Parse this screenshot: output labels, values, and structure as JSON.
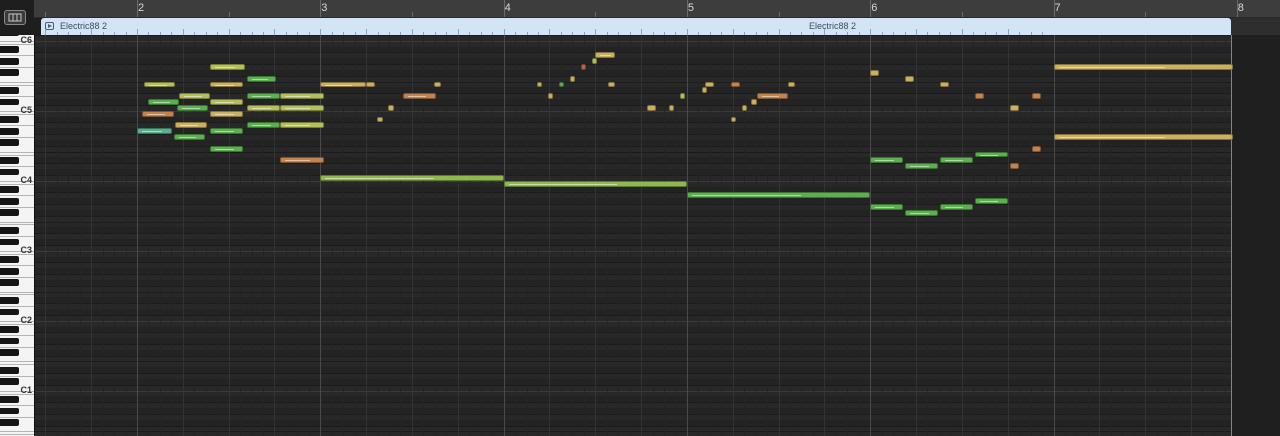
{
  "ruler": {
    "bar_labels": [
      "2",
      "3",
      "4",
      "5",
      "6",
      "7",
      "8"
    ]
  },
  "region": {
    "name_1": "Electric88 2",
    "name_2": "Electric88 2",
    "color": "#d4e4f7"
  },
  "keyboard": {
    "octave_labels": [
      "C6",
      "C5",
      "C4",
      "C3",
      "C2",
      "C1"
    ]
  },
  "colors": {
    "green": "#5cb14f",
    "yellow_green": "#b6c05a",
    "gold": "#c9b062",
    "orange": "#c2834d",
    "teal": "#5ab08d",
    "red_orange": "#c2653f",
    "lime": "#8fb94f"
  },
  "notes": [
    {
      "pitch": 76,
      "start": 1.04,
      "dur": 0.17,
      "color": "yellow_green"
    },
    {
      "pitch": 73,
      "start": 1.06,
      "dur": 0.17,
      "color": "green"
    },
    {
      "pitch": 71,
      "start": 1.03,
      "dur": 0.17,
      "color": "orange"
    },
    {
      "pitch": 68,
      "start": 1.0,
      "dur": 0.19,
      "color": "teal"
    },
    {
      "pitch": 74,
      "start": 1.23,
      "dur": 0.17,
      "color": "yellow_green"
    },
    {
      "pitch": 72,
      "start": 1.22,
      "dur": 0.17,
      "color": "green"
    },
    {
      "pitch": 69,
      "start": 1.21,
      "dur": 0.17,
      "color": "gold"
    },
    {
      "pitch": 67,
      "start": 1.2,
      "dur": 0.17,
      "color": "green"
    },
    {
      "pitch": 79,
      "start": 1.4,
      "dur": 0.19,
      "color": "yellow_green"
    },
    {
      "pitch": 76,
      "start": 1.4,
      "dur": 0.18,
      "color": "gold"
    },
    {
      "pitch": 73,
      "start": 1.4,
      "dur": 0.18,
      "color": "yellow_green"
    },
    {
      "pitch": 71,
      "start": 1.4,
      "dur": 0.18,
      "color": "gold"
    },
    {
      "pitch": 68,
      "start": 1.4,
      "dur": 0.18,
      "color": "green"
    },
    {
      "pitch": 65,
      "start": 1.4,
      "dur": 0.18,
      "color": "green"
    },
    {
      "pitch": 77,
      "start": 1.6,
      "dur": 0.16,
      "color": "green"
    },
    {
      "pitch": 74,
      "start": 1.6,
      "dur": 0.18,
      "color": "green"
    },
    {
      "pitch": 72,
      "start": 1.6,
      "dur": 0.18,
      "color": "yellow_green"
    },
    {
      "pitch": 69,
      "start": 1.6,
      "dur": 0.18,
      "color": "green"
    },
    {
      "pitch": 74,
      "start": 1.78,
      "dur": 0.24,
      "color": "yellow_green"
    },
    {
      "pitch": 72,
      "start": 1.78,
      "dur": 0.24,
      "color": "yellow_green"
    },
    {
      "pitch": 69,
      "start": 1.78,
      "dur": 0.24,
      "color": "yellow_green"
    },
    {
      "pitch": 63,
      "start": 1.78,
      "dur": 0.24,
      "color": "orange"
    },
    {
      "pitch": 76,
      "start": 2.0,
      "dur": 0.25,
      "color": "gold"
    },
    {
      "pitch": 76,
      "start": 2.25,
      "dur": 0.05,
      "color": "gold"
    },
    {
      "pitch": 70,
      "start": 2.31,
      "dur": 0.03,
      "color": "gold"
    },
    {
      "pitch": 72,
      "start": 2.37,
      "dur": 0.03,
      "color": "gold"
    },
    {
      "pitch": 74,
      "start": 2.45,
      "dur": 0.18,
      "color": "orange"
    },
    {
      "pitch": 76,
      "start": 2.62,
      "dur": 0.04,
      "color": "gold"
    },
    {
      "pitch": 60,
      "start": 2.0,
      "dur": 1.0,
      "color": "lime"
    },
    {
      "pitch": 59,
      "start": 3.0,
      "dur": 1.0,
      "color": "lime"
    },
    {
      "pitch": 57,
      "start": 4.0,
      "dur": 1.0,
      "color": "green"
    },
    {
      "pitch": 76,
      "start": 3.18,
      "dur": 0.03,
      "color": "gold"
    },
    {
      "pitch": 74,
      "start": 3.24,
      "dur": 0.03,
      "color": "gold"
    },
    {
      "pitch": 76,
      "start": 3.3,
      "dur": 0.03,
      "color": "green"
    },
    {
      "pitch": 77,
      "start": 3.36,
      "dur": 0.03,
      "color": "gold"
    },
    {
      "pitch": 79,
      "start": 3.42,
      "dur": 0.03,
      "color": "red_orange"
    },
    {
      "pitch": 80,
      "start": 3.48,
      "dur": 0.03,
      "color": "yellow_green"
    },
    {
      "pitch": 81,
      "start": 3.5,
      "dur": 0.11,
      "color": "gold"
    },
    {
      "pitch": 76,
      "start": 3.57,
      "dur": 0.04,
      "color": "gold"
    },
    {
      "pitch": 72,
      "start": 3.78,
      "dur": 0.05,
      "color": "gold"
    },
    {
      "pitch": 72,
      "start": 3.9,
      "dur": 0.03,
      "color": "gold"
    },
    {
      "pitch": 74,
      "start": 3.96,
      "dur": 0.03,
      "color": "yellow_green"
    },
    {
      "pitch": 76,
      "start": 4.1,
      "dur": 0.05,
      "color": "gold"
    },
    {
      "pitch": 75,
      "start": 4.08,
      "dur": 0.03,
      "color": "gold"
    },
    {
      "pitch": 76,
      "start": 4.24,
      "dur": 0.05,
      "color": "orange"
    },
    {
      "pitch": 70,
      "start": 4.24,
      "dur": 0.03,
      "color": "gold"
    },
    {
      "pitch": 72,
      "start": 4.3,
      "dur": 0.03,
      "color": "gold"
    },
    {
      "pitch": 73,
      "start": 4.35,
      "dur": 0.03,
      "color": "gold"
    },
    {
      "pitch": 74,
      "start": 4.38,
      "dur": 0.17,
      "color": "orange"
    },
    {
      "pitch": 76,
      "start": 4.55,
      "dur": 0.04,
      "color": "gold"
    },
    {
      "pitch": 78,
      "start": 5.0,
      "dur": 0.05,
      "color": "gold"
    },
    {
      "pitch": 77,
      "start": 5.19,
      "dur": 0.05,
      "color": "gold"
    },
    {
      "pitch": 76,
      "start": 5.38,
      "dur": 0.05,
      "color": "gold"
    },
    {
      "pitch": 74,
      "start": 5.57,
      "dur": 0.05,
      "color": "orange"
    },
    {
      "pitch": 72,
      "start": 5.76,
      "dur": 0.05,
      "color": "gold"
    },
    {
      "pitch": 74,
      "start": 5.88,
      "dur": 0.05,
      "color": "orange"
    },
    {
      "pitch": 65,
      "start": 5.88,
      "dur": 0.05,
      "color": "orange"
    },
    {
      "pitch": 62,
      "start": 5.76,
      "dur": 0.05,
      "color": "orange"
    },
    {
      "pitch": 63,
      "start": 5.0,
      "dur": 0.18,
      "color": "green"
    },
    {
      "pitch": 62,
      "start": 5.19,
      "dur": 0.18,
      "color": "green"
    },
    {
      "pitch": 63,
      "start": 5.38,
      "dur": 0.18,
      "color": "green"
    },
    {
      "pitch": 64,
      "start": 5.57,
      "dur": 0.18,
      "color": "green"
    },
    {
      "pitch": 55,
      "start": 5.0,
      "dur": 0.18,
      "color": "green"
    },
    {
      "pitch": 54,
      "start": 5.19,
      "dur": 0.18,
      "color": "green"
    },
    {
      "pitch": 55,
      "start": 5.38,
      "dur": 0.18,
      "color": "green"
    },
    {
      "pitch": 56,
      "start": 5.57,
      "dur": 0.18,
      "color": "green"
    },
    {
      "pitch": 79,
      "start": 6.0,
      "dur": 0.98,
      "color": "gold"
    },
    {
      "pitch": 67,
      "start": 6.0,
      "dur": 0.98,
      "color": "gold"
    }
  ]
}
